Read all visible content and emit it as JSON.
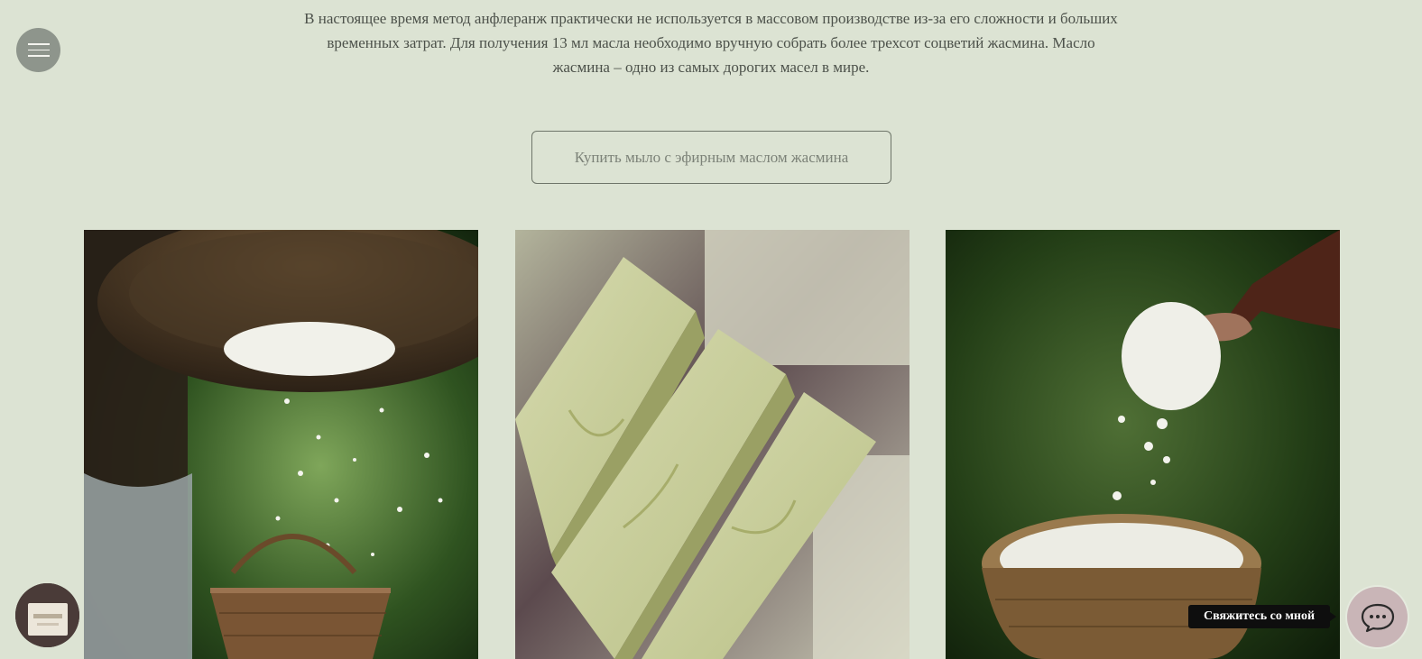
{
  "menu": {
    "icon": "hamburger-menu-icon"
  },
  "intro": {
    "line1": "В настоящее время метод анфлеранж практически не используется в массовом производстве из-за его сложности и больших",
    "line2": "временных затрат. Для получения 13 мл масла необходимо вручную собрать более трехсот соцветий жасмина. Масло",
    "line3": "жасмина – одно из самых дорогих масел в мире."
  },
  "cta": {
    "label": "Купить мыло с эфирным маслом жасмина"
  },
  "gallery": {
    "images": [
      {
        "subject": "basket-pouring-jasmine-petals"
      },
      {
        "subject": "jasmine-soap-bars"
      },
      {
        "subject": "hand-dropping-jasmine-into-basket"
      }
    ]
  },
  "chat": {
    "label": "Свяжитесь со мной",
    "icon": "chat-bubble-icon"
  },
  "colors": {
    "background": "#dce3d3",
    "menu_button": "#8e958c",
    "chat_button": "#c9b5b7"
  }
}
